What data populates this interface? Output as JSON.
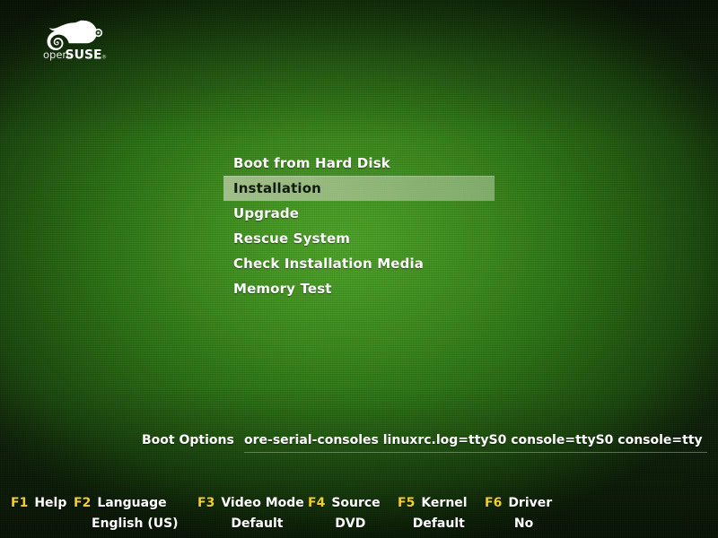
{
  "branding": {
    "logo_icon": "opensuse-geeko-icon",
    "wordmark_light": "open",
    "wordmark_bold": "SUSE",
    "wordmark_mark": "®"
  },
  "colors": {
    "background_center": "#4a9c28",
    "background_edge": "#14330a",
    "background_corner_dark": "#17200f",
    "selection_bar": "#abc494",
    "selection_text": "#111a0c",
    "text": "#ffffff",
    "fkey_accent": "#f2d027"
  },
  "menu": {
    "selected_index": 1,
    "items": [
      {
        "label": "Boot from Hard Disk"
      },
      {
        "label": "Installation"
      },
      {
        "label": "Upgrade"
      },
      {
        "label": "Rescue System"
      },
      {
        "label": "Check Installation Media"
      },
      {
        "label": "Memory Test"
      }
    ]
  },
  "boot_options": {
    "label": "Boot Options",
    "value": "ore-serial-consoles linuxrc.log=ttyS0 console=ttyS0 console=tty",
    "placeholder": ""
  },
  "function_keys": [
    {
      "key": "F1",
      "label": "Help",
      "value": ""
    },
    {
      "key": "F2",
      "label": "Language",
      "value": "English (US)"
    },
    {
      "key": "F3",
      "label": "Video Mode",
      "value": "Default"
    },
    {
      "key": "F4",
      "label": "Source",
      "value": "DVD"
    },
    {
      "key": "F5",
      "label": "Kernel",
      "value": "Default"
    },
    {
      "key": "F6",
      "label": "Driver",
      "value": "No"
    }
  ]
}
